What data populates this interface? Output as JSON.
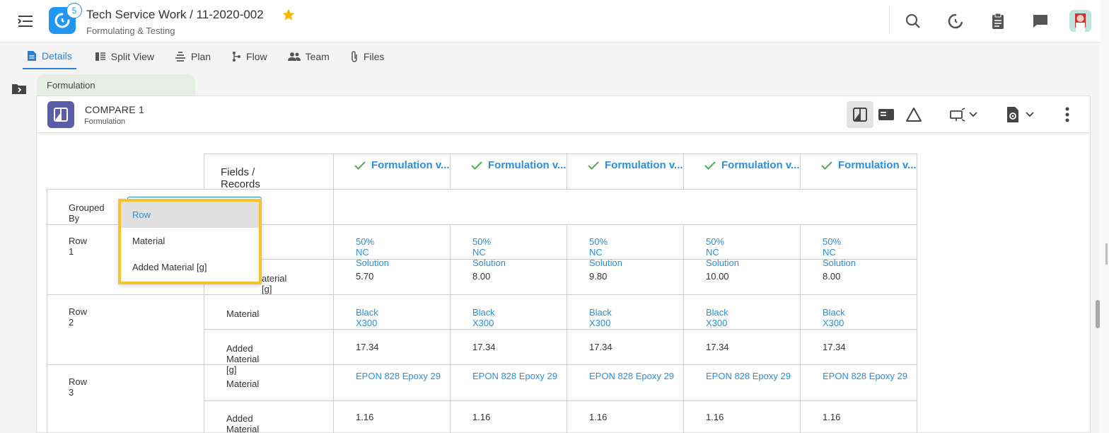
{
  "header": {
    "title": "Tech Service Work / 11-2020-002",
    "subtitle": "Formulating & Testing",
    "badge_count": "5",
    "icons": [
      "search-icon",
      "sync-icon",
      "clipboard-icon",
      "chat-icon"
    ]
  },
  "tabs": [
    {
      "label": "Details",
      "icon": "document-icon",
      "active": true
    },
    {
      "label": "Split View",
      "icon": "split-view-icon",
      "active": false
    },
    {
      "label": "Plan",
      "icon": "plan-icon",
      "active": false
    },
    {
      "label": "Flow",
      "icon": "flow-icon",
      "active": false
    },
    {
      "label": "Team",
      "icon": "team-icon",
      "active": false
    },
    {
      "label": "Files",
      "icon": "paperclip-icon",
      "active": false
    }
  ],
  "breadcrumb": {
    "label": "Formulation"
  },
  "card": {
    "title": "COMPARE 1",
    "subtitle": "Formulation"
  },
  "table": {
    "fields_header": "Fields / Records",
    "grouped_by_label": "Grouped By",
    "records": [
      "Formulation v...",
      "Formulation v...",
      "Formulation v...",
      "Formulation v...",
      "Formulation v..."
    ],
    "rows": [
      {
        "label": "Row 1",
        "fields": [
          {
            "name": "Material",
            "values": [
              "50% NC Solution",
              "50% NC Solution",
              "50% NC Solution",
              "50% NC Solution",
              "50% NC Solution"
            ]
          },
          {
            "name": "Added Material [g]",
            "values": [
              "5.70",
              "8.00",
              "9.80",
              "10.00",
              "8.00"
            ]
          }
        ]
      },
      {
        "label": "Row 2",
        "fields": [
          {
            "name": "Material",
            "values": [
              "Black X300",
              "Black X300",
              "Black X300",
              "Black X300",
              "Black X300"
            ]
          },
          {
            "name": "Added Material [g]",
            "values": [
              "17.34",
              "17.34",
              "17.34",
              "17.34",
              "17.34"
            ]
          }
        ]
      },
      {
        "label": "Row 3",
        "fields": [
          {
            "name": "Material",
            "values": [
              "EPON 828 Epoxy 29",
              "EPON 828 Epoxy 29",
              "EPON 828 Epoxy 29",
              "EPON 828 Epoxy 29",
              "EPON 828 Epoxy 29"
            ]
          },
          {
            "name": "Added Material [g]",
            "values": [
              "1.16",
              "1.16",
              "1.16",
              "1.16",
              "1.16"
            ]
          }
        ]
      }
    ]
  },
  "row1_field2_visible_fragment": "aterial [g]",
  "dropdown": {
    "options": [
      "Row",
      "Material",
      "Added Material [g]"
    ],
    "selected": "Row"
  },
  "colors": {
    "accent": "#2a8fe0",
    "logo": "#2196f3",
    "compare": "#5b5ea6",
    "highlight": "#fbc02d",
    "check": "#4caf50"
  }
}
